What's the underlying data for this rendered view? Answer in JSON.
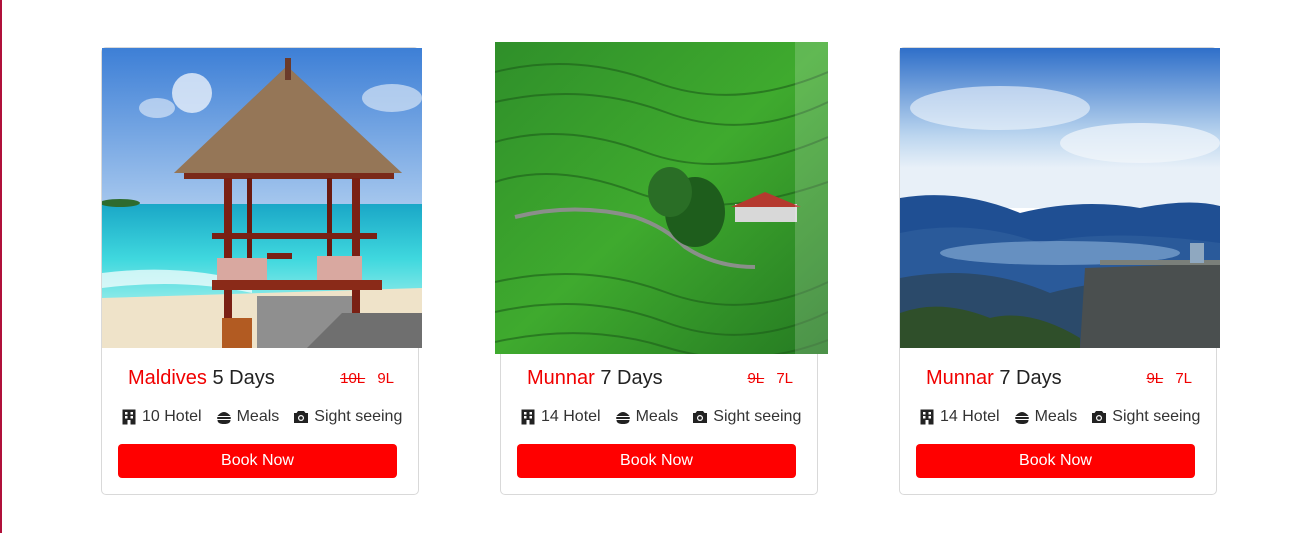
{
  "packages": [
    {
      "place": "Maldives",
      "duration": "5 Days",
      "old_price": "10L",
      "new_price": "9L",
      "features": {
        "hotel": "10 Hotel",
        "meals": "Meals",
        "sightseeing": "Sight seeing"
      },
      "button_label": "Book Now",
      "image": "maldives-beach-gazebo"
    },
    {
      "place": "Munnar",
      "duration": "7 Days",
      "old_price": "9L",
      "new_price": "7L",
      "features": {
        "hotel": "14 Hotel",
        "meals": "Meals",
        "sightseeing": "Sight seeing"
      },
      "button_label": "Book Now",
      "image": "munnar-tea-plantation"
    },
    {
      "place": "Munnar",
      "duration": "7 Days",
      "old_price": "9L",
      "new_price": "7L",
      "features": {
        "hotel": "14 Hotel",
        "meals": "Meals",
        "sightseeing": "Sight seeing"
      },
      "button_label": "Book Now",
      "image": "munnar-misty-mountains"
    }
  ],
  "icons": {
    "hotel": "building-icon",
    "meals": "burger-icon",
    "sightseeing": "camera-icon"
  },
  "colors": {
    "accent": "#f00000",
    "button": "#ff0000",
    "button_text": "#ffffff",
    "card_border": "#d9d9d9"
  }
}
